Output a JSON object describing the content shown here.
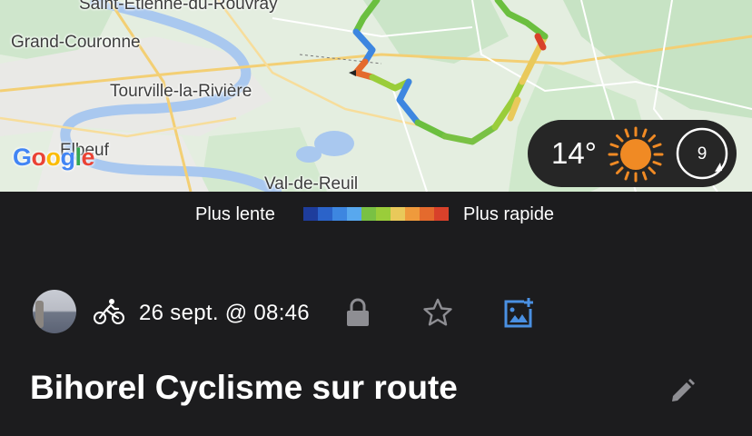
{
  "map": {
    "places": [
      {
        "name": "Saint-Étienne-du-Rouvray"
      },
      {
        "name": "Grand-Couronne"
      },
      {
        "name": "Tourville-la-Rivière"
      },
      {
        "name": "Elbeuf"
      },
      {
        "name": "Val-de-Reuil"
      }
    ],
    "attribution": "Google",
    "attribution_colors": [
      "#4285F4",
      "#EA4335",
      "#FBBC05",
      "#4285F4",
      "#34A853",
      "#EA4335"
    ]
  },
  "weather": {
    "temperature": "14°",
    "condition_icon": "sun-icon",
    "uv_index": "9"
  },
  "speed_legend": {
    "slow_label": "Plus lente",
    "fast_label": "Plus rapide",
    "colors": [
      "#1e3d9c",
      "#2b63c9",
      "#3d86e0",
      "#58a8ee",
      "#79c144",
      "#9acd3a",
      "#e9c95a",
      "#ef9a3c",
      "#e46a2d",
      "#d8412a"
    ]
  },
  "activity": {
    "sport_icon": "bicycle-icon",
    "datetime": "26 sept. @ 08:46",
    "privacy_icon": "lock-icon",
    "favorite_icon": "star-icon",
    "add_photo_icon": "add-photo-icon",
    "accent_color": "#4a90e2",
    "title": "Bihorel Cyclisme sur route",
    "edit_icon": "pencil-icon"
  }
}
